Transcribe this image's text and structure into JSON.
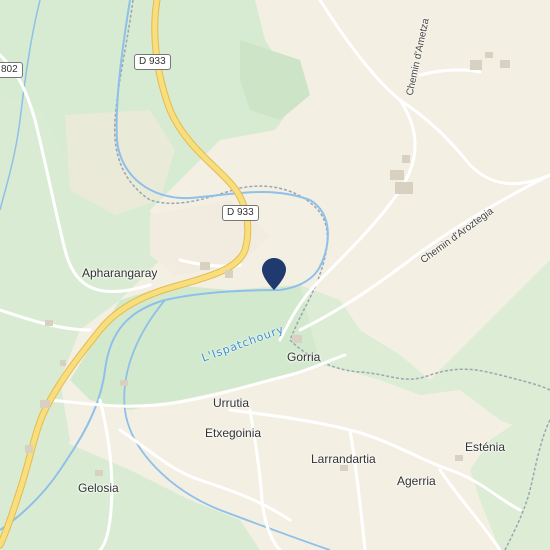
{
  "map": {
    "places": [
      {
        "name": "Apharangaray"
      },
      {
        "name": "Gorria"
      },
      {
        "name": "Urrutia"
      },
      {
        "name": "Etxegoinia"
      },
      {
        "name": "Larrandartia"
      },
      {
        "name": "Agerria"
      },
      {
        "name": "Esténia"
      },
      {
        "name": "Gelosia"
      }
    ],
    "streets": [
      {
        "name": "Chemin d'Ametza"
      },
      {
        "name": "Chemin d'Aroztegia"
      }
    ],
    "road_shields": [
      {
        "label": "D 933"
      },
      {
        "label": "D 933"
      },
      {
        "label": "802"
      }
    ],
    "river": {
      "name": "L'Ispatchoury",
      "color": "#7fb6e8"
    },
    "colors": {
      "land": "#f3efe3",
      "forest": "#d6ebd1",
      "main_road": "#f5d66b",
      "pin": "#1f3a6e"
    },
    "marker": {
      "icon": "location-pin-icon"
    }
  }
}
